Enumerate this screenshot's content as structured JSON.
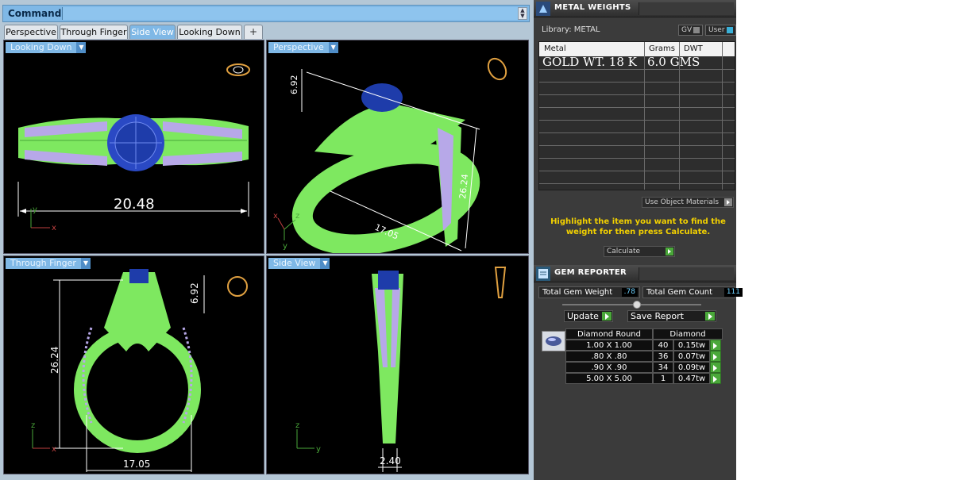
{
  "command": {
    "label": "Command:",
    "value": ""
  },
  "tabs": [
    {
      "label": "Perspective",
      "active": false
    },
    {
      "label": "Through Finger",
      "active": false
    },
    {
      "label": "Side View",
      "active": true
    },
    {
      "label": "Looking Down",
      "active": false
    },
    {
      "label": "+",
      "active": false
    }
  ],
  "viewports": {
    "top_left": {
      "label": "Looking Down",
      "dims": {
        "width": "20.48"
      },
      "axes": {
        "v": "y",
        "h": "x"
      }
    },
    "top_right": {
      "label": "Perspective",
      "dims": {
        "a": "6.92",
        "b": "26.24",
        "c": "17.05"
      },
      "axes": {
        "a": "z",
        "b": "x",
        "c": "y"
      }
    },
    "bottom_left": {
      "label": "Through Finger",
      "dims": {
        "height": "26.24",
        "prong": "6.92",
        "width": "17.05"
      },
      "axes": {
        "v": "z",
        "h": "x"
      }
    },
    "bottom_right": {
      "label": "Side View",
      "dims": {
        "width": "2.40"
      },
      "axes": {
        "v": "z",
        "h": "y"
      }
    }
  },
  "metal_weights": {
    "title": "METAL WEIGHTS",
    "library": "Library: METAL",
    "toggles": {
      "gv": "GV",
      "user": "User"
    },
    "columns": [
      "Metal",
      "Grams",
      "DWT"
    ],
    "row": {
      "metal": "GOLD WT. 18 K",
      "grams": "6.0 GMS",
      "dwt": ""
    },
    "use_object_materials": "Use Object Materials",
    "hint": "Highlight the item you want to find the weight for then press Calculate.",
    "calculate": "Calculate"
  },
  "gem_reporter": {
    "title": "GEM REPORTER",
    "total_weight_label": "Total Gem Weight",
    "total_weight_value": ".78",
    "total_count_label": "Total Gem Count",
    "total_count_value": "111",
    "update": "Update",
    "save_report": "Save Report",
    "headers": [
      "Diamond Round",
      "Diamond"
    ],
    "rows": [
      {
        "size": "1.00 X 1.00",
        "count": "40",
        "tw": "0.15tw"
      },
      {
        "size": ".80 X .80",
        "count": "36",
        "tw": "0.07tw"
      },
      {
        "size": ".90 X .90",
        "count": "34",
        "tw": "0.09tw"
      },
      {
        "size": "5.00 X 5.00",
        "count": "1",
        "tw": "0.47tw"
      }
    ]
  },
  "colors": {
    "metal_mesh": "#7ee860",
    "gem": "#1e3caa",
    "accent": "#7fb8e6",
    "hint": "#f2d000"
  }
}
